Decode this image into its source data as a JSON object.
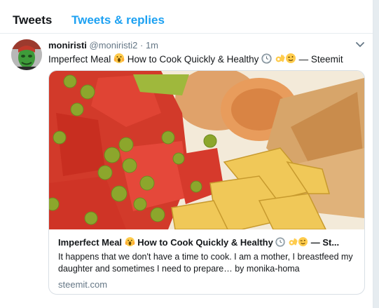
{
  "tabs": {
    "tweets": "Tweets",
    "replies": "Tweets & replies"
  },
  "tweet": {
    "display_name": "moniristi",
    "screen_name": "@moniristi2",
    "separator": "·",
    "time": "1m",
    "text_before": "Imperfect Meal ",
    "text_after": " How to Cook Quickly & Healthy ",
    "text_end": " — Steemit",
    "card": {
      "title_before": "Imperfect Meal ",
      "title_after": " How to Cook Quickly & Healthy ",
      "title_end": " — St...",
      "description": "It happens that we don't have a time to cook. I am a mother, I breastfeed my daughter and sometimes I need to prepare… by monika-homa",
      "domain": "steemit.com"
    }
  },
  "icons": [
    "avatar",
    "scream-emoji",
    "clock-emoji",
    "ok-hand-emoji",
    "wink-emoji",
    "chevron-down-icon",
    "food-photo"
  ],
  "colors": {
    "accent": "#1da1f2",
    "text": "#14171a",
    "muted": "#657786",
    "background": "#e6ecf0"
  }
}
